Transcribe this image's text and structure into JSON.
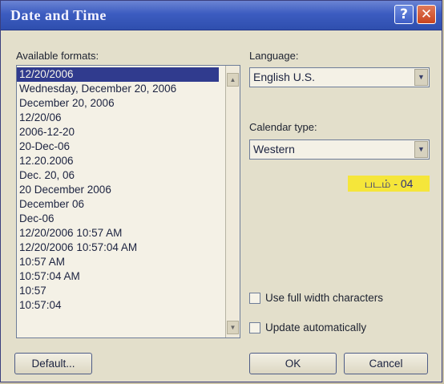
{
  "window": {
    "title": "Date and Time",
    "help_label": "?",
    "close_label": "✕"
  },
  "formats": {
    "label": "Available formats:",
    "items": [
      "12/20/2006",
      "Wednesday, December 20, 2006",
      "December 20, 2006",
      "12/20/06",
      "2006-12-20",
      "20-Dec-06",
      "12.20.2006",
      "Dec. 20, 06",
      "20 December 2006",
      "December 06",
      "Dec-06",
      "12/20/2006 10:57 AM",
      "12/20/2006 10:57:04 AM",
      "10:57 AM",
      "10:57:04 AM",
      "10:57",
      "10:57:04"
    ],
    "selected_index": 0
  },
  "language": {
    "label": "Language:",
    "value": "English U.S."
  },
  "calendar": {
    "label": "Calendar type:",
    "value": "Western"
  },
  "figure_tag": "படம் - 04",
  "options": {
    "full_width_label": "Use full width characters",
    "update_auto_label": "Update automatically"
  },
  "buttons": {
    "default_label": "Default...",
    "ok_label": "OK",
    "cancel_label": "Cancel"
  },
  "colors": {
    "titlebar": "#3c5cc0",
    "selection": "#303b8e",
    "dialog_bg": "#e3dfcb",
    "tag_bg": "#f5e63a"
  }
}
